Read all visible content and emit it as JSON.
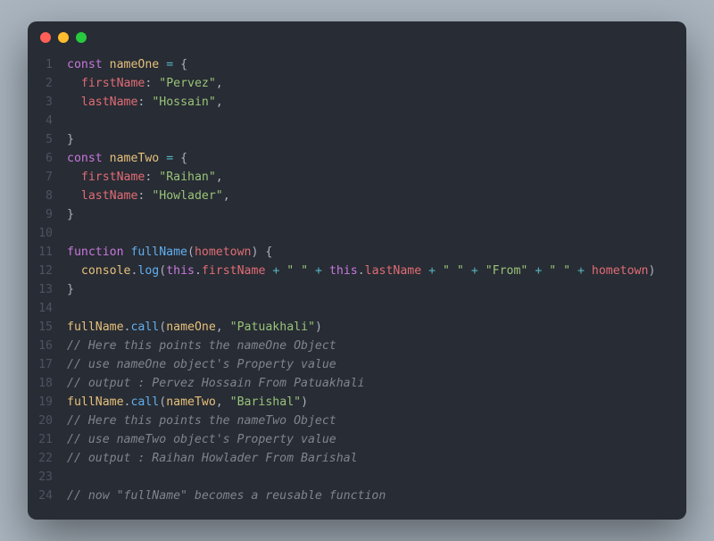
{
  "window": {
    "controls": [
      "close",
      "minimize",
      "zoom"
    ]
  },
  "code": {
    "lineCount": 24,
    "lines": [
      [
        [
          "kw",
          "const"
        ],
        [
          "pun",
          " "
        ],
        [
          "name",
          "nameOne"
        ],
        [
          "pun",
          " "
        ],
        [
          "op",
          "="
        ],
        [
          "pun",
          " {"
        ]
      ],
      [
        [
          "pun",
          "  "
        ],
        [
          "prop",
          "firstName"
        ],
        [
          "pun",
          ": "
        ],
        [
          "str",
          "\"Pervez\""
        ],
        [
          "pun",
          ","
        ]
      ],
      [
        [
          "pun",
          "  "
        ],
        [
          "prop",
          "lastName"
        ],
        [
          "pun",
          ": "
        ],
        [
          "str",
          "\"Hossain\""
        ],
        [
          "pun",
          ","
        ]
      ],
      [],
      [
        [
          "pun",
          "}"
        ]
      ],
      [
        [
          "kw",
          "const"
        ],
        [
          "pun",
          " "
        ],
        [
          "name",
          "nameTwo"
        ],
        [
          "pun",
          " "
        ],
        [
          "op",
          "="
        ],
        [
          "pun",
          " {"
        ]
      ],
      [
        [
          "pun",
          "  "
        ],
        [
          "prop",
          "firstName"
        ],
        [
          "pun",
          ": "
        ],
        [
          "str",
          "\"Raihan\""
        ],
        [
          "pun",
          ","
        ]
      ],
      [
        [
          "pun",
          "  "
        ],
        [
          "prop",
          "lastName"
        ],
        [
          "pun",
          ": "
        ],
        [
          "str",
          "\"Howlader\""
        ],
        [
          "pun",
          ","
        ]
      ],
      [
        [
          "pun",
          "}"
        ]
      ],
      [],
      [
        [
          "kw",
          "function"
        ],
        [
          "pun",
          " "
        ],
        [
          "fn",
          "fullName"
        ],
        [
          "pun",
          "("
        ],
        [
          "prop",
          "hometown"
        ],
        [
          "pun",
          ") {"
        ]
      ],
      [
        [
          "pun",
          "  "
        ],
        [
          "name",
          "console"
        ],
        [
          "pun",
          "."
        ],
        [
          "fn",
          "log"
        ],
        [
          "pun",
          "("
        ],
        [
          "kw",
          "this"
        ],
        [
          "pun",
          "."
        ],
        [
          "prop",
          "firstName"
        ],
        [
          "pun",
          " "
        ],
        [
          "op",
          "+"
        ],
        [
          "pun",
          " "
        ],
        [
          "str",
          "\" \""
        ],
        [
          "pun",
          " "
        ],
        [
          "op",
          "+"
        ],
        [
          "pun",
          " "
        ],
        [
          "kw",
          "this"
        ],
        [
          "pun",
          "."
        ],
        [
          "prop",
          "lastName"
        ],
        [
          "pun",
          " "
        ],
        [
          "op",
          "+"
        ],
        [
          "pun",
          " "
        ],
        [
          "str",
          "\" \""
        ],
        [
          "pun",
          " "
        ],
        [
          "op",
          "+"
        ],
        [
          "pun",
          " "
        ],
        [
          "str",
          "\"From\""
        ],
        [
          "pun",
          " "
        ],
        [
          "op",
          "+"
        ],
        [
          "pun",
          " "
        ],
        [
          "str",
          "\" \""
        ],
        [
          "pun",
          " "
        ],
        [
          "op",
          "+"
        ],
        [
          "pun",
          " "
        ],
        [
          "prop",
          "hometown"
        ],
        [
          "pun",
          ")"
        ]
      ],
      [
        [
          "pun",
          "}"
        ]
      ],
      [],
      [
        [
          "name",
          "fullName"
        ],
        [
          "pun",
          "."
        ],
        [
          "fn",
          "call"
        ],
        [
          "pun",
          "("
        ],
        [
          "name",
          "nameOne"
        ],
        [
          "pun",
          ", "
        ],
        [
          "str",
          "\"Patuakhali\""
        ],
        [
          "pun",
          ")"
        ]
      ],
      [
        [
          "cmt",
          "// Here this points the nameOne Object"
        ]
      ],
      [
        [
          "cmt",
          "// use nameOne object's Property value"
        ]
      ],
      [
        [
          "cmt",
          "// output : Pervez Hossain From Patuakhali"
        ]
      ],
      [
        [
          "name",
          "fullName"
        ],
        [
          "pun",
          "."
        ],
        [
          "fn",
          "call"
        ],
        [
          "pun",
          "("
        ],
        [
          "name",
          "nameTwo"
        ],
        [
          "pun",
          ", "
        ],
        [
          "str",
          "\"Barishal\""
        ],
        [
          "pun",
          ")"
        ]
      ],
      [
        [
          "cmt",
          "// Here this points the nameTwo Object"
        ]
      ],
      [
        [
          "cmt",
          "// use nameTwo object's Property value"
        ]
      ],
      [
        [
          "cmt",
          "// output : Raihan Howlader From Barishal"
        ]
      ],
      [],
      [
        [
          "cmt",
          "// now \"fullName\" becomes a reusable function"
        ]
      ]
    ]
  }
}
